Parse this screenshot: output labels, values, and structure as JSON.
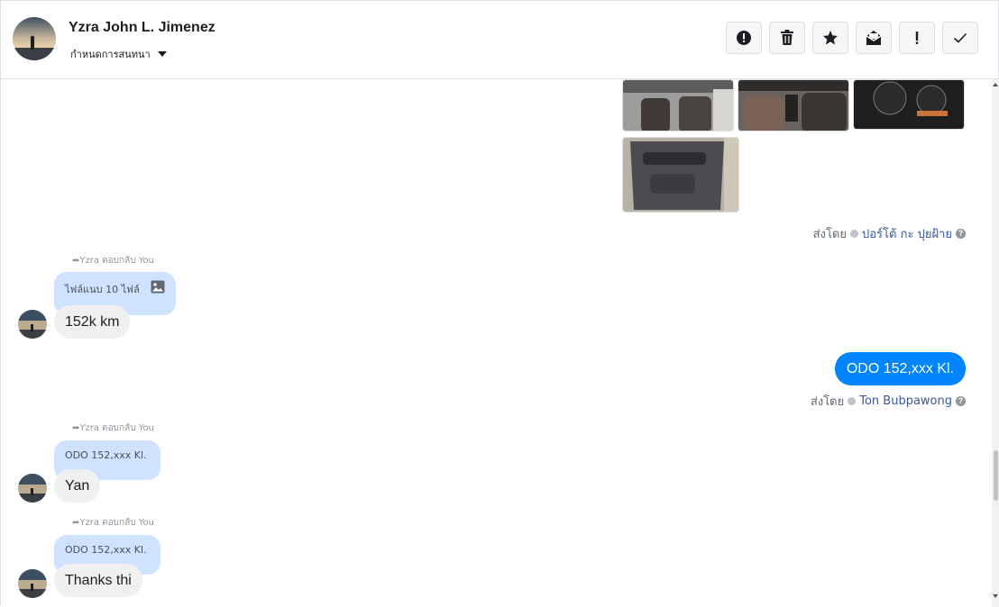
{
  "header": {
    "contact_name": "Yzra John L. Jimenez",
    "assign_label": "กำหนดการสนทนา",
    "toolbar_icons": [
      "alert-circle-icon",
      "trash-icon",
      "star-icon",
      "envelope-open-icon",
      "exclamation-icon",
      "checkmark-icon"
    ]
  },
  "attachments": {
    "sent_by_prefix": "ส่งโดย",
    "sent_by_name": "ปอร์โต้ กะ ปุยฝ้าย",
    "help": "?"
  },
  "messages": {
    "reply1": {
      "note": "Yzra ตอบกลับ You",
      "quote": "ไฟล์แนบ 10 ไฟล์",
      "text": "152k km"
    },
    "outgoing": {
      "text": "ODO 152,xxx Kl.",
      "sent_by_prefix": "ส่งโดย",
      "sent_by_name": "Ton Bubpawong",
      "help": "?"
    },
    "reply2": {
      "note": "Yzra ตอบกลับ You",
      "quote": "ODO 152,xxx Kl.",
      "text": "Yan"
    },
    "reply3": {
      "note": "Yzra ตอบกลับ You",
      "quote": "ODO 152,xxx Kl.",
      "text": "Thanks thi"
    }
  },
  "colors": {
    "accent": "#0084ff",
    "quote_bg": "#cfe2ff",
    "incoming_bg": "#f1f0f0",
    "link": "#385898"
  }
}
